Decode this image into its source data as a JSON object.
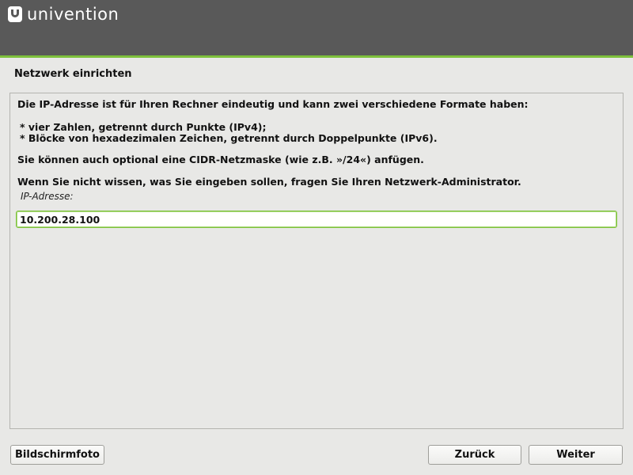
{
  "header": {
    "brand": "univention"
  },
  "step": {
    "title": "Netzwerk einrichten"
  },
  "panel": {
    "intro": "Die IP-Adresse ist für Ihren Rechner eindeutig und kann zwei verschiedene Formate haben:",
    "bullets": [
      "* vier Zahlen, getrennt durch Punkte (IPv4);",
      "* Blöcke von hexadezimalen Zeichen, getrennt durch Doppelpunkte (IPv6)."
    ],
    "cidr_note": "Sie können auch optional eine CIDR-Netzmaske (wie z.B. »/24«) anfügen.",
    "help_note": "Wenn Sie nicht wissen, was Sie eingeben sollen, fragen Sie Ihren Netzwerk-Administrator.",
    "field": {
      "label": "IP-Adresse:",
      "value": "10.200.28.100"
    }
  },
  "buttons": {
    "screenshot": "Bildschirmfoto",
    "back": "Zurück",
    "next": "Weiter"
  },
  "colors": {
    "header_bg": "#595959",
    "accent": "#7ec13c"
  }
}
